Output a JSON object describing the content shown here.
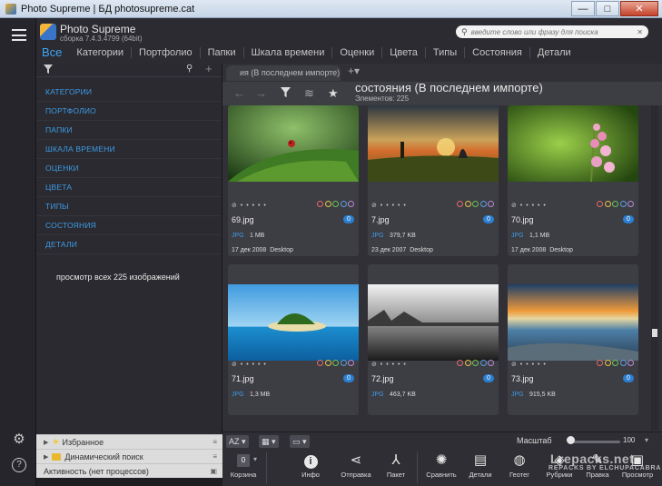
{
  "window": {
    "title": "Photo Supreme | БД photosupreme.cat",
    "minimize": "—",
    "maximize": "□",
    "close": "✕"
  },
  "app": {
    "name": "Photo Supreme",
    "version": "сборка 7.4.3.4799 (64bit)"
  },
  "search": {
    "placeholder": "введите слово или фразу для поиска"
  },
  "tabs": [
    "Все",
    "Категории",
    "Портфолио",
    "Папки",
    "Шкала времени",
    "Оценки",
    "Цвета",
    "Типы",
    "Состояния",
    "Детали"
  ],
  "left_panel": {
    "categories": [
      "КАТЕГОРИИ",
      "ПОРТФОЛИО",
      "ПАПКИ",
      "ШКАЛА ВРЕМЕНИ",
      "ОЦЕНКИ",
      "ЦВЕТА",
      "ТИПЫ",
      "СОСТОЯНИЯ",
      "ДЕТАЛИ"
    ],
    "view_all": "просмотр всех 225 изображений",
    "favorites": "Избранное",
    "dynamic_search": "Динамический поиск",
    "activity": "Активность (нет процессов)"
  },
  "main": {
    "tab_label": "ия (В последнем импорте)",
    "collection_title": "состояния (В последнем импорте)",
    "collection_count": "Элементов: 225"
  },
  "images": [
    {
      "name": "69.jpg",
      "type": "JPG",
      "size": "1 MB",
      "date": "17 дек 2008",
      "source": "Desktop",
      "badge": "0"
    },
    {
      "name": "7.jpg",
      "type": "JPG",
      "size": "379,7 KB",
      "date": "23 дек 2007",
      "source": "Desktop",
      "badge": "0"
    },
    {
      "name": "70.jpg",
      "type": "JPG",
      "size": "1,1 MB",
      "date": "17 дек 2008",
      "source": "Desktop",
      "badge": "0"
    },
    {
      "name": "71.jpg",
      "type": "JPG",
      "size": "1,3 MB",
      "date": "",
      "source": "",
      "badge": "0"
    },
    {
      "name": "72.jpg",
      "type": "JPG",
      "size": "463,7 KB",
      "date": "",
      "source": "",
      "badge": "0"
    },
    {
      "name": "73.jpg",
      "type": "JPG",
      "size": "915,5 KB",
      "date": "",
      "source": "",
      "badge": "0"
    }
  ],
  "toolbar": {
    "sort_label": "AZ",
    "zoom_label": "Масштаб",
    "zoom_value": "100",
    "zoom_fraction": 0.05,
    "basket_count": "0",
    "items": [
      {
        "label": "Корзина",
        "icon": "basket-icon"
      },
      {
        "label": "Инфо",
        "icon": "info-icon"
      },
      {
        "label": "Отправка",
        "icon": "share-icon"
      },
      {
        "label": "Пакет",
        "icon": "batch-icon"
      },
      {
        "label": "Сравнить",
        "icon": "compare-icon"
      },
      {
        "label": "Детали",
        "icon": "details-icon"
      },
      {
        "label": "Геотег",
        "icon": "geotag-icon"
      },
      {
        "label": "Рубрики",
        "icon": "rubrics-icon"
      },
      {
        "label": "Правка",
        "icon": "edit-icon"
      },
      {
        "label": "Просмотр",
        "icon": "view-icon"
      }
    ]
  },
  "watermark": {
    "line1": "Lrepacks.net",
    "line2": "REPACKS BY ELCHUPACABRA"
  }
}
